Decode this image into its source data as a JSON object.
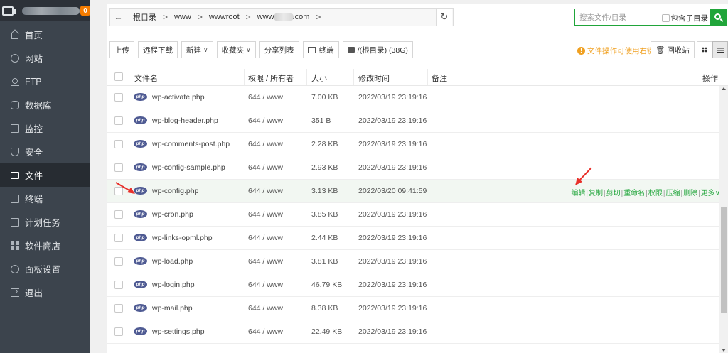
{
  "sidebar": {
    "badge": "0",
    "items": [
      {
        "label": "首页",
        "icon": "home-icon"
      },
      {
        "label": "网站",
        "icon": "globe-icon"
      },
      {
        "label": "FTP",
        "icon": "ftp-icon"
      },
      {
        "label": "数据库",
        "icon": "database-icon"
      },
      {
        "label": "监控",
        "icon": "monitor-chart-icon"
      },
      {
        "label": "安全",
        "icon": "shield-icon"
      },
      {
        "label": "文件",
        "icon": "folder-icon",
        "active": true
      },
      {
        "label": "终端",
        "icon": "terminal-icon"
      },
      {
        "label": "计划任务",
        "icon": "calendar-icon"
      },
      {
        "label": "软件商店",
        "icon": "apps-icon"
      },
      {
        "label": "面板设置",
        "icon": "settings-icon"
      },
      {
        "label": "退出",
        "icon": "logout-icon"
      }
    ]
  },
  "pathbar": {
    "back": "←",
    "crumbs": [
      "根目录",
      "www",
      "wwwroot",
      "www",
      ".com"
    ],
    "separator": ">",
    "refresh": "↻"
  },
  "search": {
    "placeholder": "搜索文件/目录",
    "subdir_label": "包含子目录"
  },
  "toolbar": {
    "upload": "上传",
    "remote_download": "远程下载",
    "new": "新建",
    "favorites": "收藏夹",
    "share_list": "分享列表",
    "terminal": "终端",
    "disk": "/(根目录) (38G)",
    "hint": "文件操作可使用右键",
    "recycle": "回收站"
  },
  "table": {
    "headers": {
      "name": "文件名",
      "perm": "权限 / 所有者",
      "size": "大小",
      "mtime": "修改时间",
      "note": "备注",
      "ops": "操作"
    },
    "file_icon_text": "php",
    "rows": [
      {
        "name": "wp-activate.php",
        "perm": "644 / www",
        "size": "7.00 KB",
        "mtime": "2022/03/19 23:19:16"
      },
      {
        "name": "wp-blog-header.php",
        "perm": "644 / www",
        "size": "351 B",
        "mtime": "2022/03/19 23:19:16"
      },
      {
        "name": "wp-comments-post.php",
        "perm": "644 / www",
        "size": "2.28 KB",
        "mtime": "2022/03/19 23:19:16"
      },
      {
        "name": "wp-config-sample.php",
        "perm": "644 / www",
        "size": "2.93 KB",
        "mtime": "2022/03/19 23:19:16"
      },
      {
        "name": "wp-config.php",
        "perm": "644 / www",
        "size": "3.13 KB",
        "mtime": "2022/03/20 09:41:59",
        "highlight": true
      },
      {
        "name": "wp-cron.php",
        "perm": "644 / www",
        "size": "3.85 KB",
        "mtime": "2022/03/19 23:19:16"
      },
      {
        "name": "wp-links-opml.php",
        "perm": "644 / www",
        "size": "2.44 KB",
        "mtime": "2022/03/19 23:19:16"
      },
      {
        "name": "wp-load.php",
        "perm": "644 / www",
        "size": "3.81 KB",
        "mtime": "2022/03/19 23:19:16"
      },
      {
        "name": "wp-login.php",
        "perm": "644 / www",
        "size": "46.79 KB",
        "mtime": "2022/03/19 23:19:16"
      },
      {
        "name": "wp-mail.php",
        "perm": "644 / www",
        "size": "8.38 KB",
        "mtime": "2022/03/19 23:19:16"
      },
      {
        "name": "wp-settings.php",
        "perm": "644 / www",
        "size": "22.49 KB",
        "mtime": "2022/03/19 23:19:16"
      }
    ],
    "row_ops": [
      "编辑",
      "复制",
      "剪切",
      "重命名",
      "权限",
      "压缩",
      "删除",
      "更多∨"
    ]
  },
  "colors": {
    "accent": "#20a53a",
    "sidebar_bg": "#3c444d",
    "badge": "#f57c00",
    "hint": "#f0a020",
    "arrow": "#e8302a"
  }
}
